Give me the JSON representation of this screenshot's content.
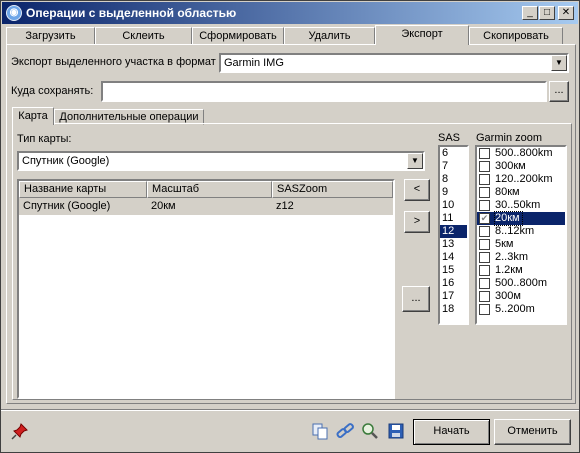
{
  "window": {
    "title": "Операции с выделенной областью",
    "min_glyph": "_",
    "max_glyph": "□",
    "close_glyph": "✕"
  },
  "tabs": [
    {
      "label": "Загрузить"
    },
    {
      "label": "Склеить"
    },
    {
      "label": "Сформировать"
    },
    {
      "label": "Удалить"
    },
    {
      "label": "Экспорт",
      "active": true
    },
    {
      "label": "Скопировать"
    }
  ],
  "export": {
    "format_label": "Экспорт выделенного участка в формат",
    "format_value": "Garmin IMG",
    "save_label": "Куда сохранять:",
    "save_value": "",
    "browse_label": "..."
  },
  "subtabs": [
    {
      "label": "Карта",
      "active": true
    },
    {
      "label": "Дополнительные операции"
    }
  ],
  "map": {
    "type_label": "Тип карты:",
    "type_value": "Спутник (Google)",
    "columns": [
      "Название карты",
      "Масштаб",
      "SASZoom"
    ],
    "rows": [
      {
        "name": "Спутник (Google)",
        "scale": "20км",
        "zoom": "z12"
      }
    ],
    "add_label": "<",
    "remove_label": ">",
    "more_label": "..."
  },
  "sas": {
    "label": "SAS",
    "items": [
      "6",
      "7",
      "8",
      "9",
      "10",
      "11",
      "12",
      "13",
      "14",
      "15",
      "16",
      "17",
      "18"
    ],
    "selected": "12"
  },
  "garmin_zoom": {
    "label": "Garmin zoom",
    "items": [
      {
        "label": "500..800km",
        "checked": false
      },
      {
        "label": "300км",
        "checked": false
      },
      {
        "label": "120..200km",
        "checked": false
      },
      {
        "label": "80км",
        "checked": false
      },
      {
        "label": "30..50km",
        "checked": false
      },
      {
        "label": "20км",
        "checked": true,
        "selected": true
      },
      {
        "label": "8..12km",
        "checked": false
      },
      {
        "label": "5км",
        "checked": false
      },
      {
        "label": "2..3km",
        "checked": false
      },
      {
        "label": "1.2км",
        "checked": false
      },
      {
        "label": "500..800m",
        "checked": false
      },
      {
        "label": "300м",
        "checked": false
      },
      {
        "label": "5..200m",
        "checked": false
      }
    ]
  },
  "footer": {
    "start_label": "Начать",
    "cancel_label": "Отменить"
  },
  "colors": {
    "titlebar_start": "#0a246a",
    "titlebar_end": "#a6caf0",
    "selection": "#0a246a",
    "face": "#d4d0c8"
  },
  "icons": [
    "pin-icon",
    "copy-icon",
    "link-icon",
    "zoom-icon",
    "save-icon"
  ]
}
